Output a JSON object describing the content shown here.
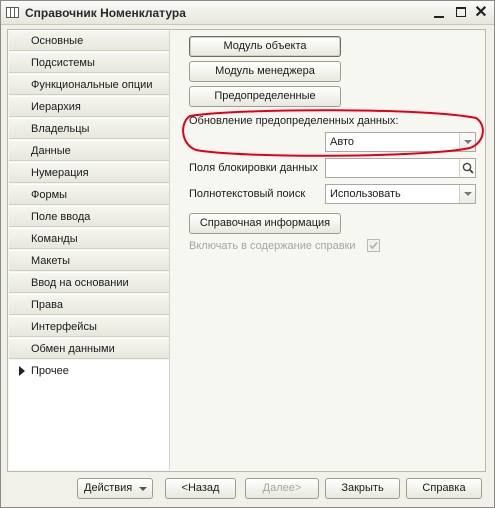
{
  "window": {
    "title": "Справочник Номенклатура",
    "close_glyph": "✕"
  },
  "sidebar": {
    "items": [
      {
        "label": "Основные"
      },
      {
        "label": "Подсистемы"
      },
      {
        "label": "Функциональные опции"
      },
      {
        "label": "Иерархия"
      },
      {
        "label": "Владельцы"
      },
      {
        "label": "Данные"
      },
      {
        "label": "Нумерация"
      },
      {
        "label": "Формы"
      },
      {
        "label": "Поле ввода"
      },
      {
        "label": "Команды"
      },
      {
        "label": "Макеты"
      },
      {
        "label": "Ввод на основании"
      },
      {
        "label": "Права"
      },
      {
        "label": "Интерфейсы"
      },
      {
        "label": "Обмен данными"
      },
      {
        "label": "Прочее",
        "active": true
      }
    ]
  },
  "content": {
    "object_module_button": "Модуль объекта",
    "manager_module_button": "Модуль менеджера",
    "predefined_button": "Предопределенные",
    "predefined_update_label": "Обновление предопределенных данных:",
    "predefined_update_value": "Авто",
    "lock_fields_label": "Поля блокировки данных",
    "lock_fields_value": "",
    "fulltext_label": "Полнотекстовый поиск",
    "fulltext_value": "Использовать",
    "help_button": "Справочная информация",
    "include_help_label": "Включать в содержание справки",
    "include_help_checked": true,
    "annotation_color": "#e0001a"
  },
  "footer": {
    "actions_button": "Действия",
    "back_button": "<Назад",
    "next_button": "Далее>",
    "close_button": "Закрыть",
    "help_button": "Справка"
  }
}
